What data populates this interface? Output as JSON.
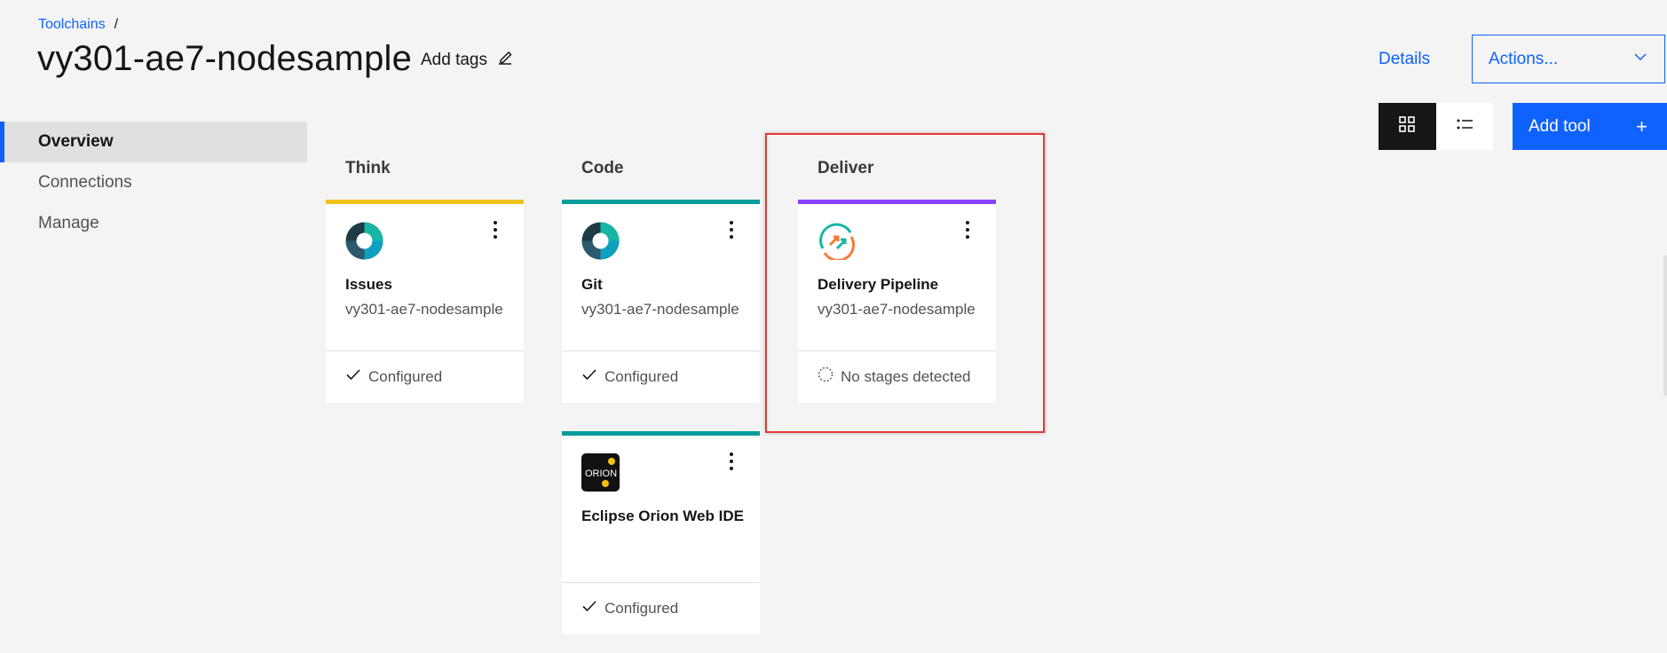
{
  "breadcrumb": {
    "link": "Toolchains",
    "separator": "/"
  },
  "title": "vy301-ae7-nodesample",
  "add_tags": "Add tags",
  "header": {
    "details": "Details",
    "actions": "Actions..."
  },
  "toolbar": {
    "add_tool": "Add tool",
    "add_tool_icon": "+"
  },
  "sidenav": {
    "items": [
      {
        "label": "Overview",
        "active": true
      },
      {
        "label": "Connections",
        "active": false
      },
      {
        "label": "Manage",
        "active": false
      }
    ]
  },
  "columns": [
    {
      "title": "Think",
      "color": "#f1c21b"
    },
    {
      "title": "Code",
      "color": "#009d9a"
    },
    {
      "title": "Deliver",
      "color": "#8a3ffc"
    }
  ],
  "cards": {
    "issues": {
      "name": "Issues",
      "sub": "vy301-ae7-nodesample",
      "status": "Configured",
      "icon": "issues-icon"
    },
    "git": {
      "name": "Git",
      "sub": "vy301-ae7-nodesample",
      "status": "Configured",
      "icon": "git-icon"
    },
    "orion": {
      "name": "Eclipse Orion Web IDE",
      "status": "Configured",
      "icon": "orion-icon",
      "logo_text": "ORION"
    },
    "pipeline": {
      "name": "Delivery Pipeline",
      "sub": "vy301-ae7-nodesample",
      "status": "No stages detected",
      "icon": "pipeline-icon"
    }
  },
  "colors": {
    "primary": "#0f62fe",
    "highlight": "#e53935"
  }
}
